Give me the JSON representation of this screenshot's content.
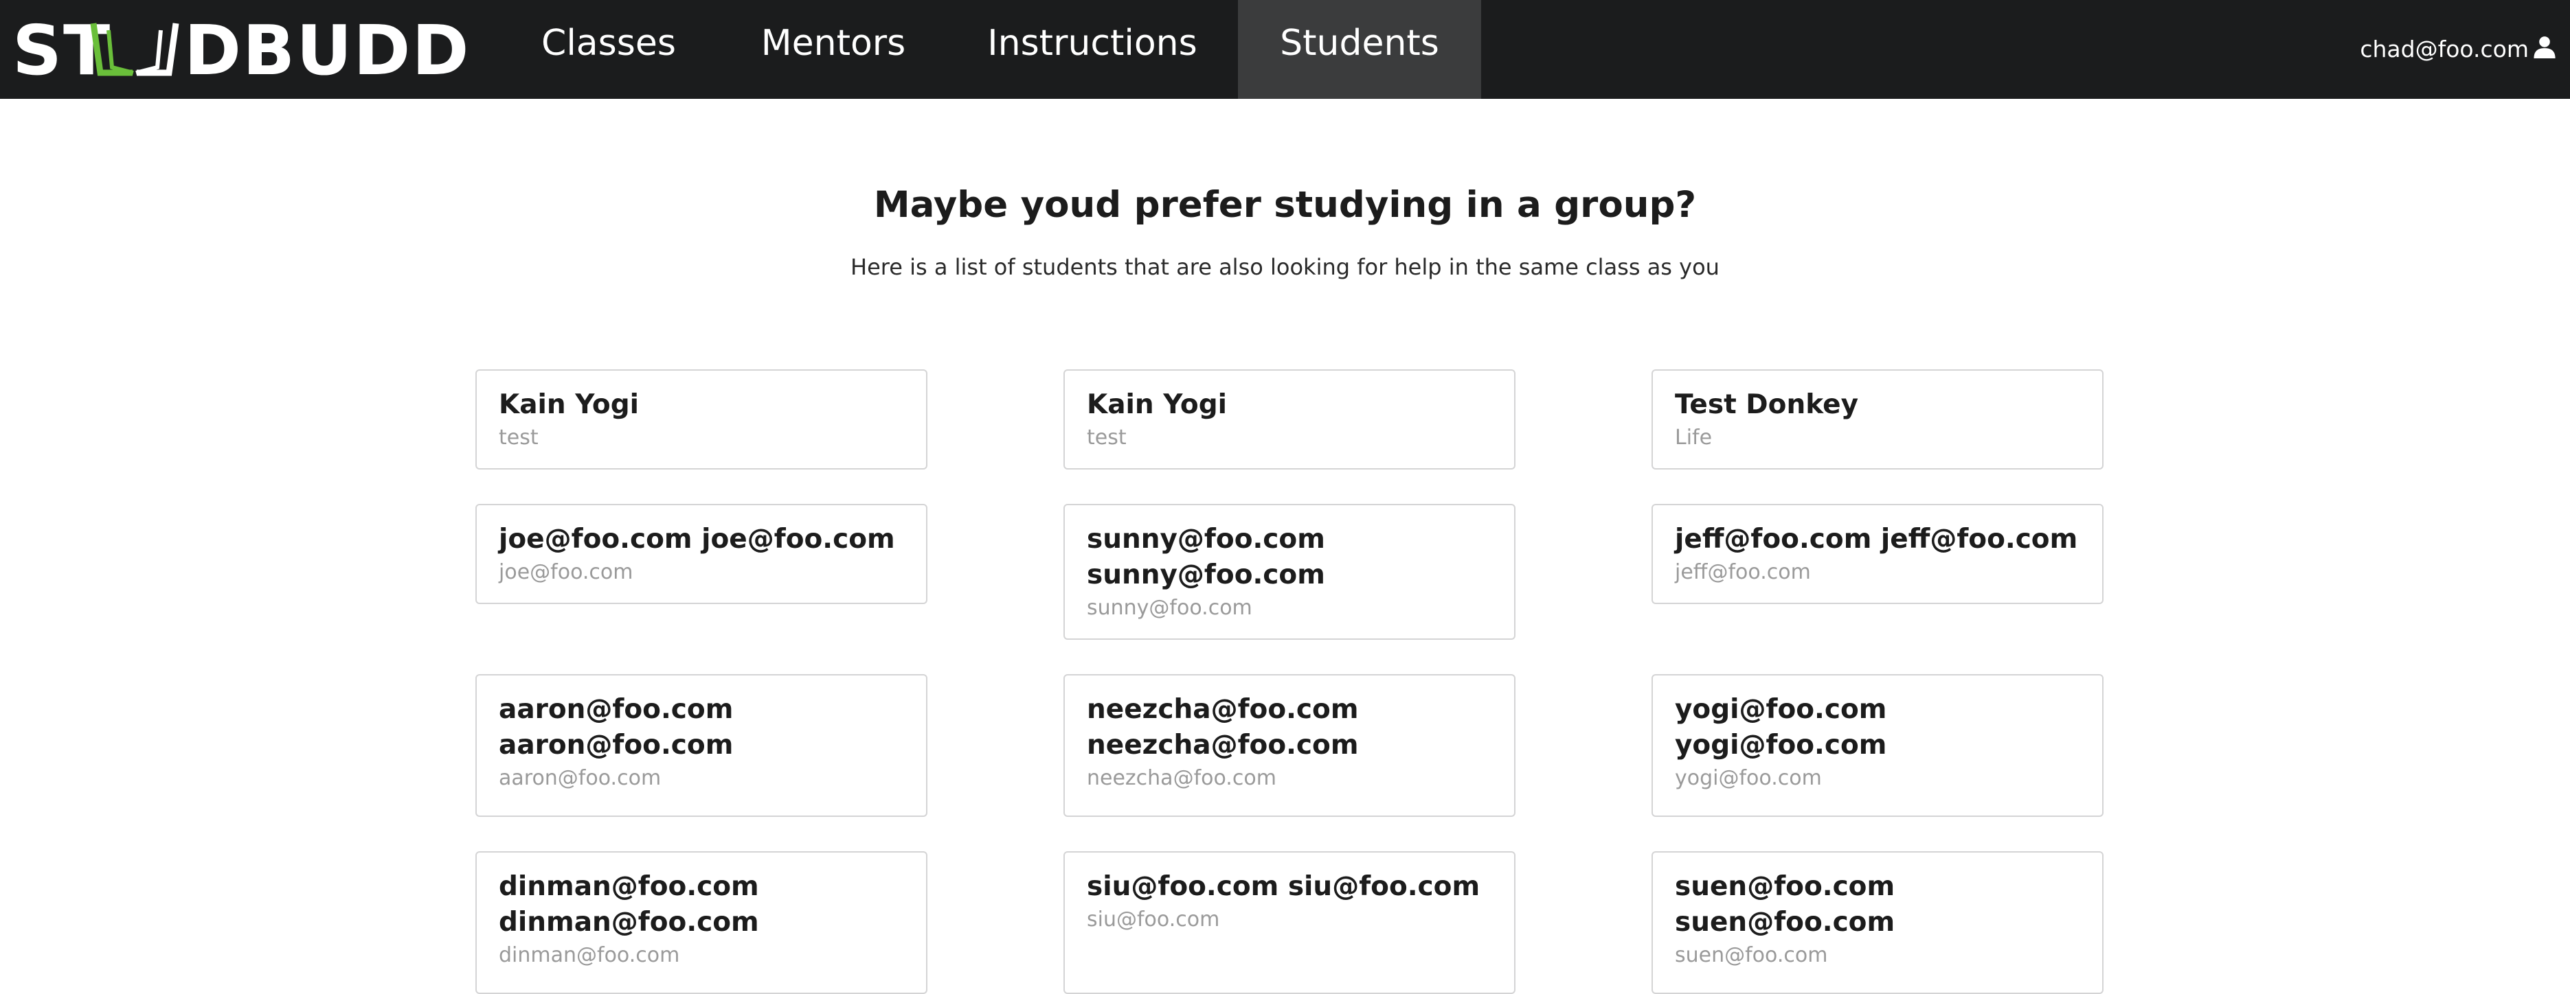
{
  "nav": {
    "logo_text": "STUDBUDD",
    "items": [
      {
        "label": "Classes",
        "active": false
      },
      {
        "label": "Mentors",
        "active": false
      },
      {
        "label": "Instructions",
        "active": false
      },
      {
        "label": "Students",
        "active": true
      }
    ],
    "user_email": "chad@foo.com",
    "user_icon": "user-icon",
    "colors": {
      "bar": "#1b1c1d",
      "active": "#3b3c3d",
      "logo_accent": "#6abf3a"
    }
  },
  "page": {
    "heading": "Maybe youd prefer studying in a group?",
    "subheading": "Here is a list of students that are also looking for help in the same class as you"
  },
  "students": [
    {
      "name": "Kain Yogi",
      "meta": "test"
    },
    {
      "name": "Kain Yogi",
      "meta": "test"
    },
    {
      "name": "Test Donkey",
      "meta": "Life"
    },
    {
      "name": "joe@foo.com joe@foo.com",
      "meta": "joe@foo.com"
    },
    {
      "name": "sunny@foo.com sunny@foo.com",
      "meta": "sunny@foo.com"
    },
    {
      "name": "jeff@foo.com jeff@foo.com",
      "meta": "jeff@foo.com"
    },
    {
      "name": "aaron@foo.com aaron@foo.com",
      "meta": "aaron@foo.com"
    },
    {
      "name": "neezcha@foo.com neezcha@foo.com",
      "meta": "neezcha@foo.com"
    },
    {
      "name": "yogi@foo.com yogi@foo.com",
      "meta": "yogi@foo.com"
    },
    {
      "name": "dinman@foo.com dinman@foo.com",
      "meta": "dinman@foo.com"
    },
    {
      "name": "siu@foo.com siu@foo.com",
      "meta": "siu@foo.com"
    },
    {
      "name": "suen@foo.com suen@foo.com",
      "meta": "suen@foo.com"
    }
  ]
}
